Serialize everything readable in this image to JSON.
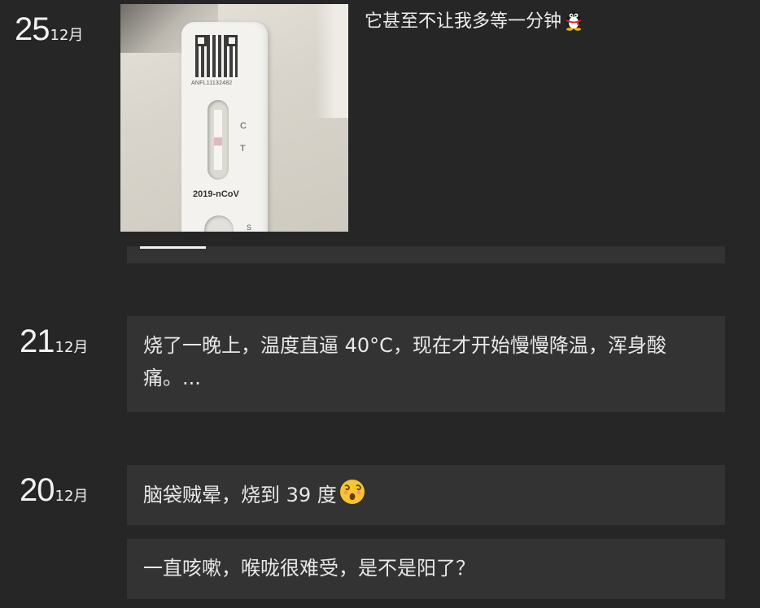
{
  "entries": [
    {
      "day": "25",
      "month": "12月",
      "caption": "它甚至不让我多等一分钟",
      "caption_emoji": "penguin-emoji",
      "photo": {
        "code": "ANFL11132482",
        "label_c": "C",
        "label_t": "T",
        "label_s": "S",
        "brand": "2019-nCoV"
      }
    },
    {
      "day": "21",
      "month": "12月",
      "text": "烧了一晚上，温度直逼 40°C，现在才开始慢慢降温，浑身酸痛。..."
    },
    {
      "day": "20",
      "month": "12月",
      "posts": [
        {
          "text": "脑袋贼晕，烧到 39 度",
          "emoji": "dizzy-face-emoji"
        },
        {
          "text": "一直咳嗽，喉咙很难受，是不是阳了？"
        }
      ]
    }
  ],
  "colors": {
    "background": "#262626",
    "card": "#333333",
    "text": "#e8e8e8"
  }
}
